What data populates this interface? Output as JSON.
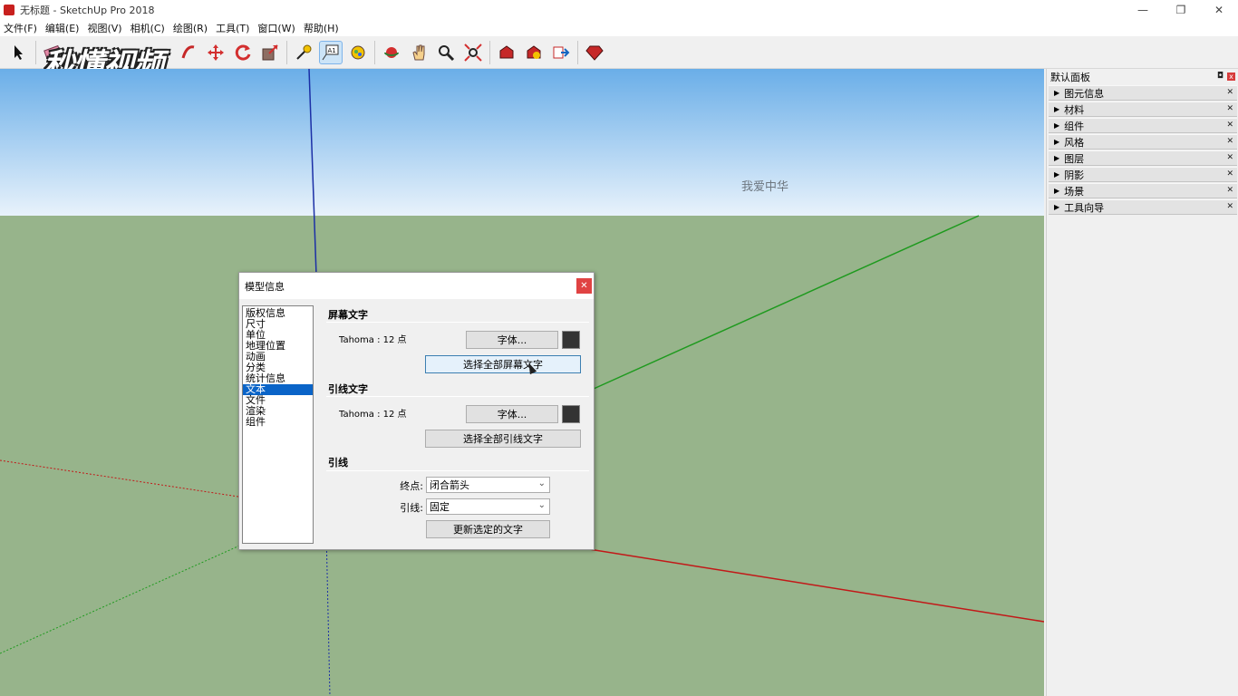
{
  "window": {
    "title": "无标题 - SketchUp Pro 2018",
    "minimize": "—",
    "restore": "❐",
    "close": "✕"
  },
  "menu": [
    "文件(F)",
    "编辑(E)",
    "视图(V)",
    "相机(C)",
    "绘图(R)",
    "工具(T)",
    "窗口(W)",
    "帮助(H)"
  ],
  "watermark": "秒懂视频",
  "toolbar": {
    "select": "select-icon",
    "eraser": "eraser-icon",
    "text_tool": "A1",
    "tools": [
      "paint-icon",
      "move-icon",
      "rotate-icon",
      "scale-icon",
      "tape-icon",
      "text-icon",
      "paint-bucket-icon",
      "orbit-icon",
      "pan-icon",
      "zoom-icon",
      "zoom-extents-icon",
      "warehouse-icon",
      "extension-icon",
      "send-icon",
      "ruby-icon"
    ]
  },
  "scene": {
    "text_label": "我爱中华",
    "sky_top": "#6aaee8",
    "sky_bottom": "#e8f2fb",
    "ground": "#97b48b"
  },
  "tray": {
    "title": "默认面板",
    "pin": "◘",
    "close": "x",
    "items": [
      "图元信息",
      "材料",
      "组件",
      "风格",
      "图层",
      "阴影",
      "场景",
      "工具向导"
    ]
  },
  "dialog": {
    "title": "模型信息",
    "close": "✕",
    "categories": [
      "版权信息",
      "尺寸",
      "单位",
      "地理位置",
      "动画",
      "分类",
      "统计信息",
      "文本",
      "文件",
      "渲染",
      "组件"
    ],
    "selected_category": "文本",
    "screen_text": {
      "title": "屏幕文字",
      "font": "Tahoma : 12 点",
      "font_button": "字体...",
      "select_all": "选择全部屏幕文字"
    },
    "leader_text": {
      "title": "引线文字",
      "font": "Tahoma : 12 点",
      "font_button": "字体...",
      "select_all": "选择全部引线文字"
    },
    "leader": {
      "title": "引线",
      "endpoint_label": "终点:",
      "endpoint_value": "闭合箭头",
      "leader_label": "引线:",
      "leader_value": "固定",
      "update_button": "更新选定的文字"
    }
  }
}
